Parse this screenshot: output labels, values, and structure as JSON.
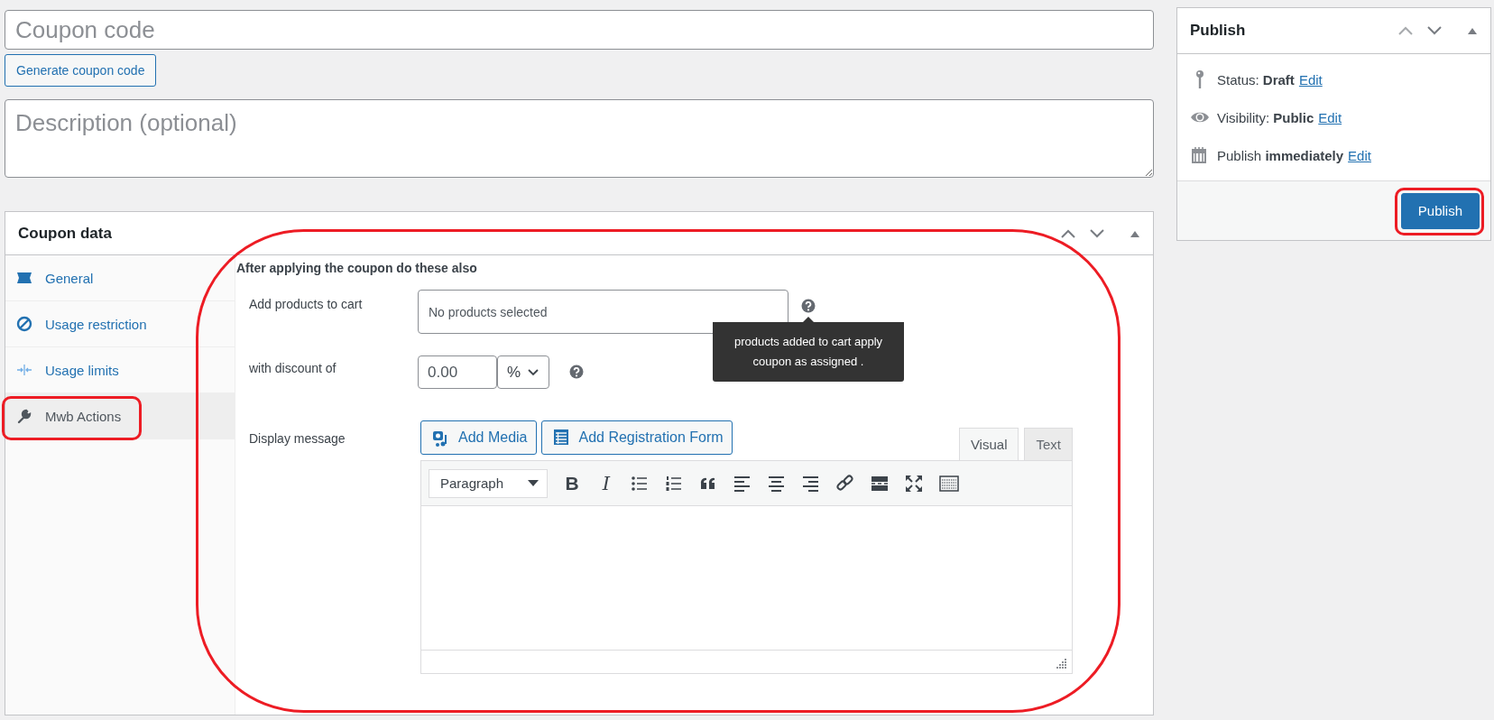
{
  "coupon_code": {
    "placeholder": "Coupon code"
  },
  "generate_button": {
    "label": "Generate coupon code"
  },
  "description": {
    "placeholder": "Description (optional)"
  },
  "coupon_data": {
    "title": "Coupon data",
    "highlighted": true,
    "tabs": [
      {
        "label": "General",
        "kind": "ticket",
        "selected": false,
        "highlighted": false
      },
      {
        "label": "Usage restriction",
        "kind": "ban",
        "selected": false,
        "highlighted": false
      },
      {
        "label": "Usage limits",
        "kind": "limits",
        "selected": false,
        "highlighted": false
      },
      {
        "label": "Mwb Actions",
        "kind": "wrench",
        "selected": true,
        "highlighted": true
      }
    ],
    "section_heading": "After applying the coupon do these also",
    "fields": [
      {
        "kind": "products",
        "label": "Add products to cart",
        "placeholder": "No products selected",
        "tooltip": "products added to cart apply coupon as assigned ."
      },
      {
        "kind": "discount",
        "label": "with discount of",
        "value": "0.00",
        "unit": "%"
      },
      {
        "kind": "editor",
        "label": "Display message",
        "buttons": [
          {
            "label": "Add Media",
            "kind": "media"
          },
          {
            "label": "Add Registration Form",
            "kind": "form"
          }
        ],
        "modes": [
          {
            "label": "Visual",
            "selected": true
          },
          {
            "label": "Text",
            "selected": false
          }
        ],
        "format": "Paragraph",
        "toolbar": [
          {
            "kind": "bold",
            "glyph": "B"
          },
          {
            "kind": "italic",
            "glyph": "I"
          },
          {
            "kind": "bullet-list"
          },
          {
            "kind": "numbered-list"
          },
          {
            "kind": "quote"
          },
          {
            "kind": "align-left"
          },
          {
            "kind": "align-center"
          },
          {
            "kind": "align-right"
          },
          {
            "kind": "link"
          },
          {
            "kind": "read-more"
          },
          {
            "kind": "fullscreen"
          },
          {
            "kind": "toolbar-toggle"
          }
        ]
      }
    ]
  },
  "publish": {
    "title": "Publish",
    "rows": [
      {
        "kind": "pin",
        "text": "Status: **Draft**",
        "link": "Edit"
      },
      {
        "kind": "eye",
        "text": "Visibility: **Public**",
        "link": "Edit"
      },
      {
        "kind": "calendar",
        "text": "Publish **immediately**",
        "link": "Edit"
      }
    ],
    "button": {
      "label": "Publish",
      "highlighted": true
    }
  }
}
